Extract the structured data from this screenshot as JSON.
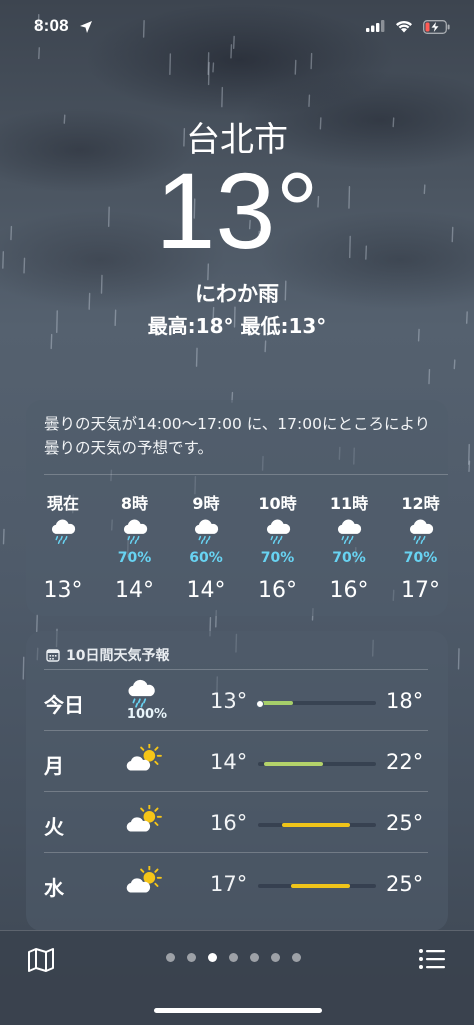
{
  "status": {
    "time": "8:08"
  },
  "location": {
    "city": "台北市",
    "temperature": "13°",
    "condition": "にわか雨",
    "high_low": "最高:18°  最低:13°"
  },
  "hourly": {
    "summary": "曇りの天気が14:00～17:00 に、17:00にところにより曇りの天気の予想です。",
    "items": [
      {
        "time": "現在",
        "icon": "rain-cloud-icon",
        "precip": "",
        "temp": "13°"
      },
      {
        "time": "8時",
        "icon": "rain-cloud-icon",
        "precip": "70%",
        "temp": "14°"
      },
      {
        "time": "9時",
        "icon": "rain-cloud-icon",
        "precip": "60%",
        "temp": "14°"
      },
      {
        "time": "10時",
        "icon": "rain-cloud-icon",
        "precip": "70%",
        "temp": "16°"
      },
      {
        "time": "11時",
        "icon": "rain-cloud-icon",
        "precip": "70%",
        "temp": "16°"
      },
      {
        "time": "12時",
        "icon": "rain-cloud-icon",
        "precip": "70%",
        "temp": "17°"
      }
    ]
  },
  "daily": {
    "header": "10日間天気予報",
    "items": [
      {
        "day": "今日",
        "icon": "rain-cloud-icon",
        "precip": "100%",
        "low": "13°",
        "high": "18°",
        "range": [
          0.0,
          0.3
        ],
        "color": "#a6cf6a",
        "current": 0.0
      },
      {
        "day": "月",
        "icon": "partly-sunny-icon",
        "precip": "",
        "low": "14°",
        "high": "22°",
        "range": [
          0.05,
          0.55
        ],
        "color": "#b4d36a"
      },
      {
        "day": "火",
        "icon": "partly-sunny-icon",
        "precip": "",
        "low": "16°",
        "high": "25°",
        "range": [
          0.2,
          0.78
        ],
        "color": "#f0c419"
      },
      {
        "day": "水",
        "icon": "partly-sunny-icon",
        "precip": "",
        "low": "17°",
        "high": "25°",
        "range": [
          0.28,
          0.78
        ],
        "color": "#f0c419"
      }
    ]
  },
  "pager": {
    "count": 7,
    "active": 2
  },
  "colors": {
    "precip": "#68d3f2",
    "accent_yellow": "#f0c419",
    "accent_green": "#a6cf6a"
  }
}
